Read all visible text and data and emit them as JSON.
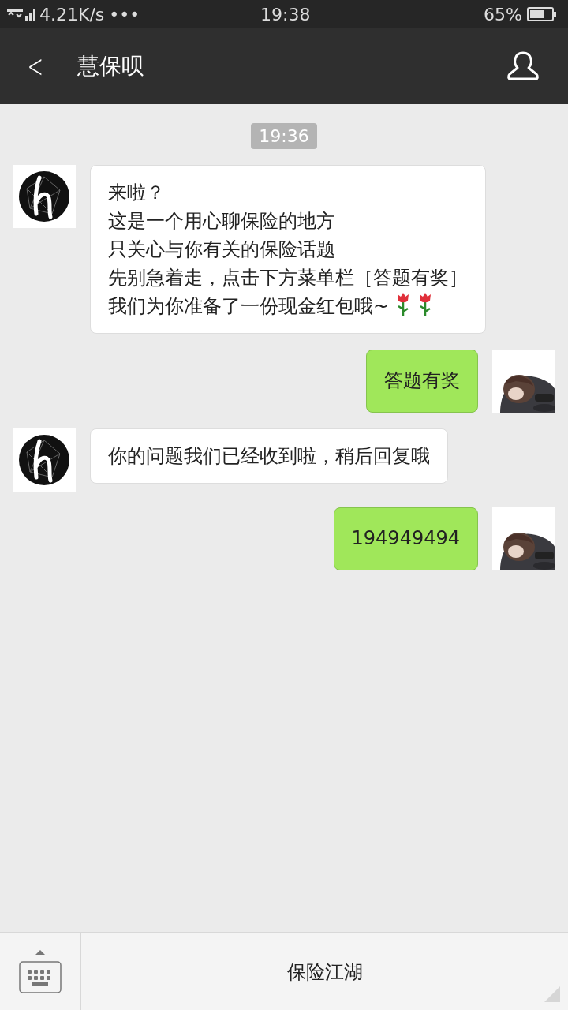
{
  "status_bar": {
    "network": "4.21K/s",
    "more": "•••",
    "time": "19:38",
    "battery": "65%"
  },
  "header": {
    "back": "<",
    "title": "慧保呗"
  },
  "chat": {
    "timestamp": "19:36",
    "messages": [
      {
        "kind": "incoming",
        "paragraphs": [
          [
            "来啦？",
            "这是一个用心聊保险的地方",
            "只关心与你有关的保险话题"
          ],
          [
            "先别急着走，点击下方菜单栏［答题有奖］",
            "我们为你准备了一份现金红包哦~"
          ]
        ],
        "emoji": [
          {
            "kind": "rose"
          },
          {
            "kind": "rose"
          }
        ]
      },
      {
        "kind": "outgoing",
        "paragraphs": [
          [
            "答题有奖"
          ]
        ]
      },
      {
        "kind": "incoming",
        "paragraphs": [
          [
            "你的问题我们已经收到啦，稍后回复哦"
          ]
        ]
      },
      {
        "kind": "outgoing",
        "paragraphs": [
          [
            "194949494"
          ]
        ]
      }
    ]
  },
  "menu_bar": {
    "items": [
      "保险江湖"
    ]
  }
}
